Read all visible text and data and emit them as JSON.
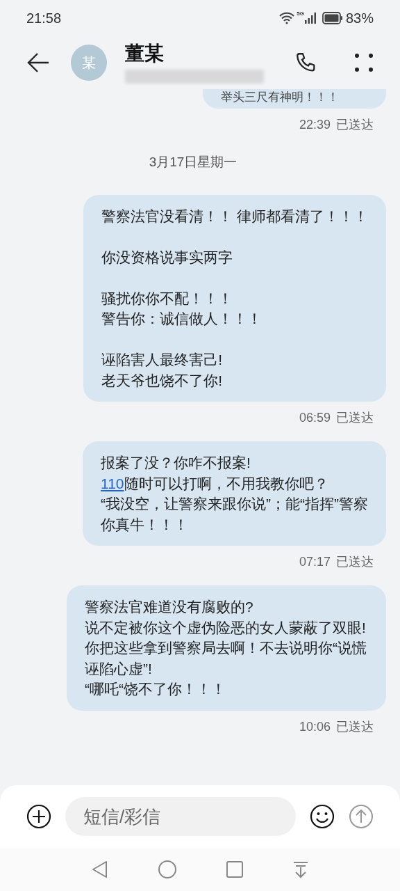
{
  "status_bar": {
    "time": "21:58",
    "battery": "83%",
    "network": "5G"
  },
  "header": {
    "avatar": "某",
    "name": "董某"
  },
  "messages": [
    {
      "paragraphs": [
        [
          {
            "kind": "plain",
            "text": "举头三尺有神明！！！"
          }
        ]
      ],
      "time": "22:39",
      "status": "已送达",
      "cut": true
    },
    {
      "date": "3月17日星期一"
    },
    {
      "paragraphs": [
        [
          {
            "kind": "plain",
            "text": "警察法官没看清！！ 律师都看清了！！！"
          }
        ],
        [
          {
            "kind": "plain",
            "text": "你没资格说事实两字"
          }
        ],
        [
          {
            "kind": "plain",
            "text": "骚扰你你不配！！！"
          },
          {
            "kind": "plain",
            "text": "警告你：诚信做人！！！"
          }
        ],
        [
          {
            "kind": "plain",
            "text": "诬陷害人最终害己!"
          },
          {
            "kind": "plain",
            "text": "老天爷也饶不了你!"
          }
        ]
      ],
      "time": "06:59",
      "status": "已送达",
      "cut": false
    },
    {
      "paragraphs": [
        [
          {
            "kind": "plain",
            "text": "报案了没？你咋不报案!"
          },
          {
            "kind": "link_lead",
            "link": "110",
            "text": "随时可以打啊，不用我教你吧？"
          },
          {
            "kind": "plain",
            "text": "“我没空，让警察来跟你说”；能“指挥”警察"
          },
          {
            "kind": "plain",
            "text": "你真牛！！！"
          }
        ]
      ],
      "time": "07:17",
      "status": "已送达",
      "cut": false
    },
    {
      "paragraphs": [
        [
          {
            "kind": "plain",
            "text": "警察法官难道没有腐败的?"
          },
          {
            "kind": "plain",
            "text": "说不定被你这个虚伪险恶的女人蒙蔽了双眼!"
          },
          {
            "kind": "plain",
            "text": "你把这些拿到警察局去啊！不去说明你“说慌诬陷心虚”!"
          },
          {
            "kind": "plain",
            "text": "“哪吒“饶不了你！！！"
          }
        ]
      ],
      "time": "10:06",
      "status": "已送达",
      "cut": false
    }
  ],
  "composer": {
    "placeholder": "短信/彩信"
  }
}
